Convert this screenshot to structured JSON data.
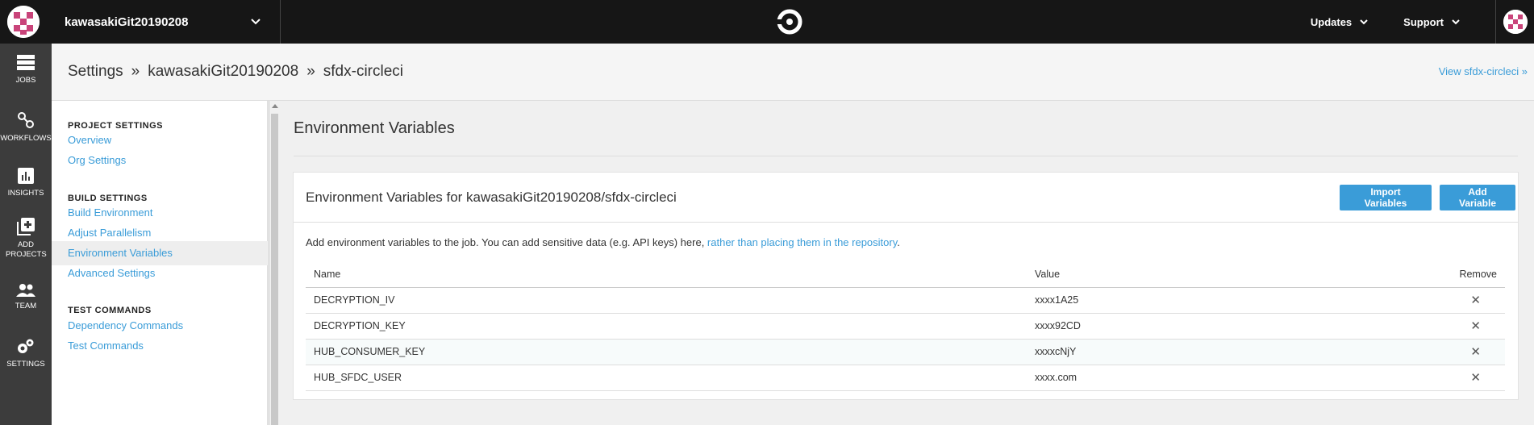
{
  "topbar": {
    "org_name": "kawasakiGit20190208",
    "updates_label": "Updates",
    "support_label": "Support"
  },
  "leftnav": {
    "items": [
      {
        "label": "JOBS",
        "icon": "jobs-icon"
      },
      {
        "label": "WORKFLOWS",
        "icon": "workflows-icon"
      },
      {
        "label": "INSIGHTS",
        "icon": "insights-icon"
      },
      {
        "label": "ADD PROJECTS",
        "icon": "add-projects-icon"
      },
      {
        "label": "TEAM",
        "icon": "team-icon"
      },
      {
        "label": "SETTINGS",
        "icon": "gear-icon"
      }
    ]
  },
  "header": {
    "crumbs": [
      "Settings",
      "kawasakiGit20190208",
      "sfdx-circleci"
    ],
    "separator": "»",
    "view_link": "View sfdx-circleci »"
  },
  "sidebar": {
    "sections": [
      {
        "title": "PROJECT SETTINGS",
        "items": [
          "Overview",
          "Org Settings"
        ]
      },
      {
        "title": "BUILD SETTINGS",
        "items": [
          "Build Environment",
          "Adjust Parallelism",
          "Environment Variables",
          "Advanced Settings"
        ]
      },
      {
        "title": "TEST COMMANDS",
        "items": [
          "Dependency Commands",
          "Test Commands"
        ]
      }
    ],
    "active_item": "Environment Variables"
  },
  "main": {
    "title": "Environment Variables",
    "card_title": "Environment Variables for kawasakiGit20190208/sfdx-circleci",
    "import_button": "Import Variables",
    "add_button": "Add Variable",
    "desc_text": "Add environment variables to the job. You can add sensitive data (e.g. API keys) here, ",
    "desc_link": "rather than placing them in the repository",
    "desc_end": ".",
    "table": {
      "headers": [
        "Name",
        "Value",
        "Remove"
      ],
      "rows": [
        {
          "name": "DECRYPTION_IV",
          "value": "xxxx1A25"
        },
        {
          "name": "DECRYPTION_KEY",
          "value": "xxxx92CD"
        },
        {
          "name": "HUB_CONSUMER_KEY",
          "value": "xxxxcNjY"
        },
        {
          "name": "HUB_SFDC_USER",
          "value": "xxxx.com"
        }
      ],
      "remove_glyph": "✕"
    }
  },
  "colors": {
    "accent": "#3a9cd8",
    "topbar": "#161616",
    "leftnav": "#3c3c3c"
  }
}
